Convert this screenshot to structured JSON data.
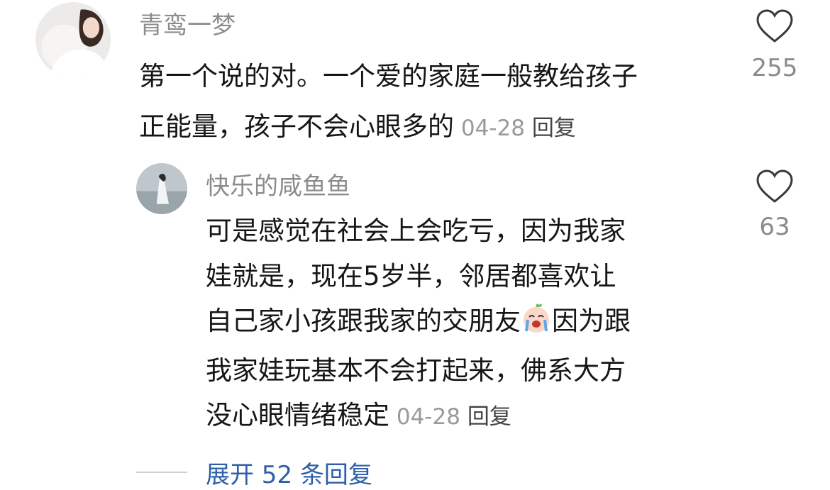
{
  "comments": [
    {
      "username": "青鸾一梦",
      "lines": [
        "第一个说的对。一个爱的家庭一般教给孩子",
        "正能量，孩子不会心眼多的"
      ],
      "date": "04-28",
      "reply_label": "回复",
      "likes": "255"
    },
    {
      "username": "快乐的咸鱼鱼",
      "lines": [
        "可是感觉在社会上会吃亏，因为我家",
        "娃就是，现在5岁半，邻居都喜欢让",
        "自己家小孩跟我家的交朋友",
        "因为跟",
        "我家娃玩基本不会打起来，佛系大方",
        "没心眼情绪稳定"
      ],
      "date": "04-28",
      "reply_label": "回复",
      "likes": "63",
      "emoji": "crying-face-emoji"
    }
  ],
  "expand_replies": "展开 52 条回复",
  "icons": {
    "like": "heart-outline-icon"
  },
  "colors": {
    "username": "#8c8c8c",
    "body": "#161616",
    "meta": "#9a9a9a",
    "link": "#2c5fa8"
  }
}
